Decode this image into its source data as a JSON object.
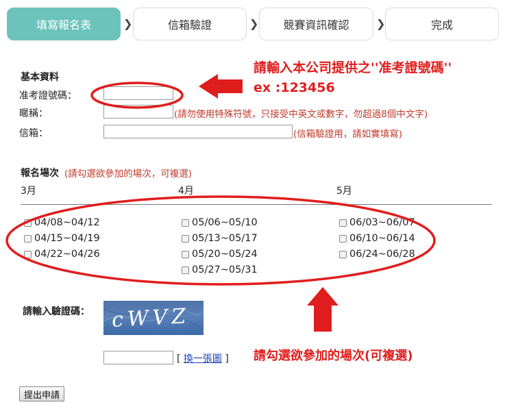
{
  "steps": [
    {
      "label": "填寫報名表",
      "active": true
    },
    {
      "label": "信箱驗證",
      "active": false
    },
    {
      "label": "競賽資訊確認",
      "active": false
    },
    {
      "label": "完成",
      "active": false
    }
  ],
  "step_arrow": "❯",
  "basic": {
    "title": "基本資料",
    "ticket_label": "准考證號碼：",
    "nickname_label": "暱稱：",
    "nickname_note": "(請勿使用特殊符號，只接受中英文或數字，勿超過8個中文字)",
    "email_label": "信箱：",
    "email_note": "(信箱驗證用，請如實填寫)",
    "ticket_value": "",
    "nickname_value": "",
    "email_value": ""
  },
  "annotations": {
    "ticket_hint_line1": "請輸入本公司提供之''准考證號碼''",
    "ticket_hint_line2": "ex :123456",
    "session_hint": "請勾選欲參加的場次(可複選)",
    "color": "#e01d1d"
  },
  "sessions": {
    "title": "報名場次",
    "note": "(請勾選欲參加的場次，可複選)",
    "months": [
      {
        "label": "3月",
        "options": [
          "04/08~04/12",
          "04/15~04/19",
          "04/22~04/26"
        ]
      },
      {
        "label": "4月",
        "options": [
          "05/06~05/10",
          "05/13~05/17",
          "05/20~05/24",
          "05/27~05/31"
        ]
      },
      {
        "label": "5月",
        "options": [
          "06/03~06/07",
          "06/10~06/14",
          "06/24~06/28"
        ]
      }
    ]
  },
  "captcha": {
    "label": "請輸入驗證碼：",
    "image_text": "cWVZ",
    "value": "",
    "refresh_open": "[",
    "refresh_label": "換一張圖",
    "refresh_close": "]"
  },
  "submit_label": "提出申請"
}
